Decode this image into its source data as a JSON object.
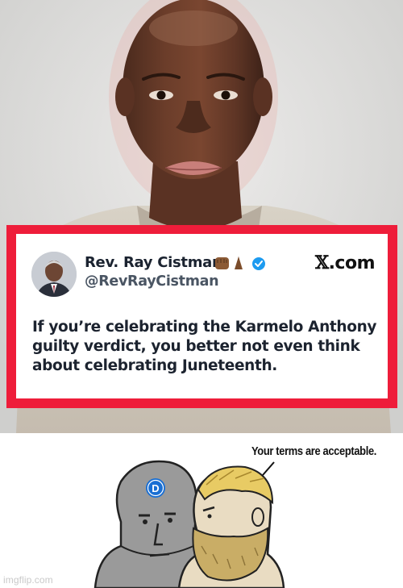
{
  "tweet": {
    "display_name": "Rev. Ray Cistman",
    "handle": "@RevRayCistman",
    "site_label": ".com",
    "site_logo": "x-logo",
    "site_logo_glyph": "𝕏",
    "verified": true,
    "name_emojis": [
      "raised-fist-emoji",
      "praying-hands-emoji"
    ],
    "body": "If you’re celebrating the Karmelo Anthony guilty verdict, you better not even think about celebrating Juneteenth.",
    "accent_border_color": "#ee1d3a",
    "verified_color": "#1d9bf0"
  },
  "meme": {
    "speech": "Your terms are acceptable.",
    "npc_badge_letter": "D",
    "npc_badge_color": "#1a6fd3"
  },
  "watermark": "imgflip.com"
}
